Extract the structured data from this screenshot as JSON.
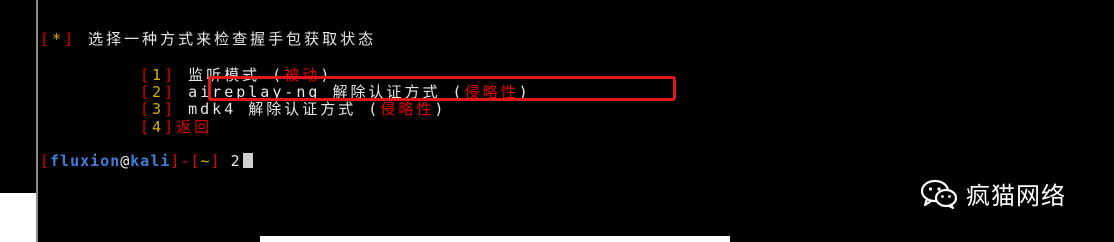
{
  "terminal": {
    "header": {
      "bracket_open": "[",
      "star": "*",
      "bracket_close": "]",
      "text": " 选择一种方式来检查握手包获取状态"
    },
    "options": [
      {
        "num": "1",
        "label": " 监听模式 (",
        "tag": "被动",
        "close": ")"
      },
      {
        "num": "2",
        "label": " aireplay-ng 解除认证方式 (",
        "tag": "侵略性",
        "close": ")"
      },
      {
        "num": "3",
        "label": " mdk4 解除认证方式 (",
        "tag": "侵略性",
        "close": ")"
      },
      {
        "num": "4",
        "label": "",
        "tag": "返回",
        "close": ""
      }
    ],
    "prompt": {
      "user": "fluxion",
      "at": "@",
      "host": "kali",
      "dir": "~",
      "input": "2"
    }
  },
  "watermark": {
    "icon": "wechat-icon",
    "text": "疯猫网络"
  },
  "colors": {
    "accent_red": "#e00000",
    "highlight_border": "#e01818",
    "number_yellow": "#d4b000",
    "prompt_blue": "#3f7fdc"
  }
}
